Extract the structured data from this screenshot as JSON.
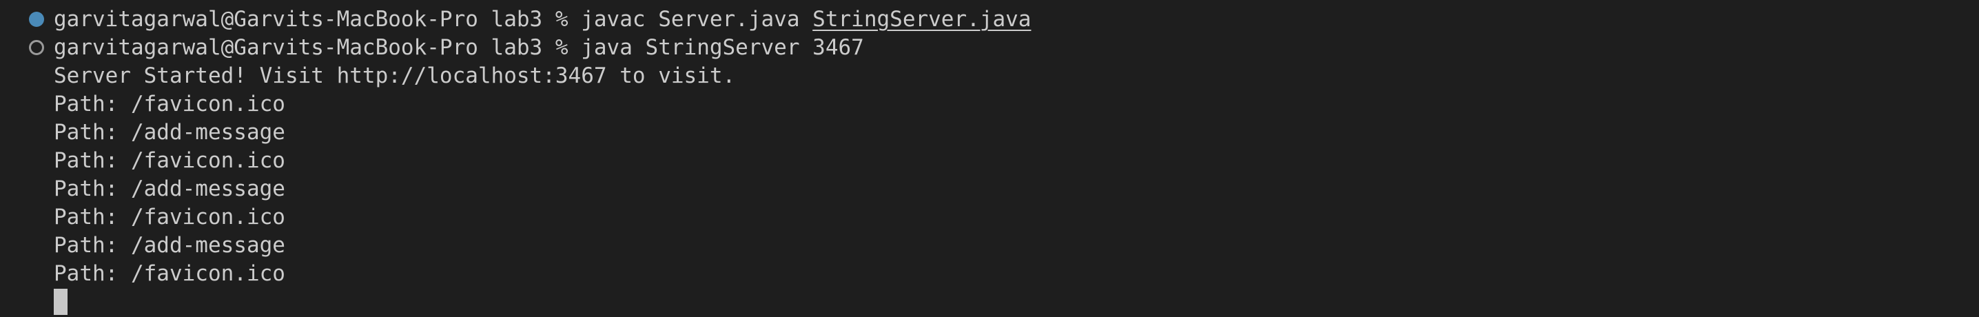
{
  "terminal": {
    "command_1": {
      "prompt": "garvitagarwal@Garvits-MacBook-Pro lab3 % ",
      "cmd": "javac Server.java ",
      "file_link": "StringServer.java",
      "status": "completed"
    },
    "command_2": {
      "prompt": "garvitagarwal@Garvits-MacBook-Pro lab3 % ",
      "cmd": "java StringServer 3467",
      "status": "running"
    },
    "output": [
      "Server Started! Visit http://localhost:3467 to visit.",
      "Path: /favicon.ico",
      "Path: /add-message",
      "Path: /favicon.ico",
      "Path: /add-message",
      "Path: /favicon.ico",
      "Path: /add-message",
      "Path: /favicon.ico"
    ]
  },
  "colors": {
    "background": "#1e1e1e",
    "text": "#cccccc",
    "marker_success": "#4a8ab8",
    "marker_running": "#9a9a9a",
    "cursor": "#c8c8c8"
  },
  "icons": {
    "command_1_marker": "filled-circle-decoration",
    "command_2_marker": "hollow-circle-decoration"
  }
}
